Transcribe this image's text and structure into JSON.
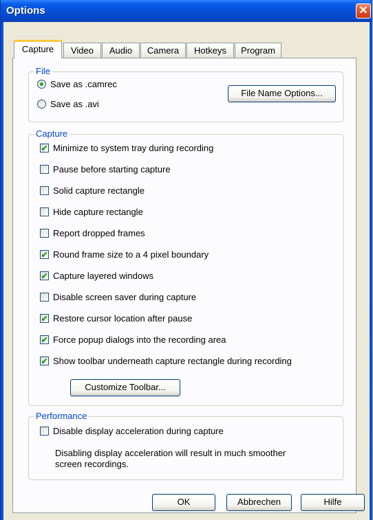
{
  "window": {
    "title": "Options",
    "close_glyph": "✕"
  },
  "tabs": [
    {
      "label": "Capture",
      "active": true
    },
    {
      "label": "Video"
    },
    {
      "label": "Audio"
    },
    {
      "label": "Camera"
    },
    {
      "label": "Hotkeys"
    },
    {
      "label": "Program"
    }
  ],
  "file_group": {
    "legend": "File",
    "radio_camrec": {
      "label": "Save as .camrec",
      "selected": true
    },
    "radio_avi": {
      "label": "Save as .avi",
      "selected": false
    },
    "file_name_options_button": "File Name Options..."
  },
  "capture_group": {
    "legend": "Capture",
    "options": [
      {
        "label": "Minimize to system tray during recording",
        "checked": true
      },
      {
        "label": "Pause before starting capture",
        "checked": false
      },
      {
        "label": "Solid capture rectangle",
        "checked": false
      },
      {
        "label": "Hide capture rectangle",
        "checked": false
      },
      {
        "label": "Report dropped frames",
        "checked": false
      },
      {
        "label": "Round frame size to a 4 pixel boundary",
        "checked": true
      },
      {
        "label": "Capture layered windows",
        "checked": true
      },
      {
        "label": "Disable screen saver during capture",
        "checked": false
      },
      {
        "label": "Restore cursor location after pause",
        "checked": true
      },
      {
        "label": "Force popup dialogs into the recording area",
        "checked": true
      },
      {
        "label": "Show toolbar underneath capture rectangle during recording",
        "checked": true
      }
    ],
    "customize_toolbar_button": "Customize Toolbar..."
  },
  "performance_group": {
    "legend": "Performance",
    "option": {
      "label": "Disable display acceleration during capture",
      "checked": false
    },
    "note_line1": "Disabling display acceleration will result in much smoother",
    "note_line2": "screen recordings."
  },
  "footer": {
    "ok": "OK",
    "cancel": "Abbrechen",
    "help": "Hilfe"
  },
  "colors": {
    "accent": "#0046d5",
    "check": "#21a121",
    "titlebar": "#0550d8"
  },
  "check_glyph": "✔"
}
